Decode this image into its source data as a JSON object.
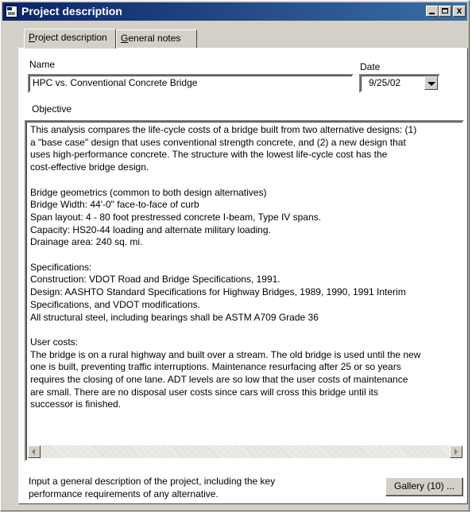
{
  "window": {
    "title": "Project description",
    "controls": {
      "minimize": "",
      "maximize": "",
      "close": "x"
    }
  },
  "tabs": [
    {
      "label_underlined": "P",
      "label_rest": "roject description",
      "active": true
    },
    {
      "label_underlined": "G",
      "label_rest": "eneral notes",
      "active": false
    }
  ],
  "form": {
    "name_label": "Name",
    "name_value": "HPC vs. Conventional Concrete Bridge",
    "date_label": "Date",
    "date_value": "9/25/02",
    "objective_label": "Objective",
    "objective_text": "This analysis compares the life-cycle costs of a bridge built from two alternative designs: (1)\na \"base case\" design that uses conventional strength concrete, and (2) a new design that\nuses high-performance concrete. The structure with the lowest life-cycle cost has the\ncost-effective bridge design.\n\nBridge geometrics (common to both design alternatives)\nBridge Width: 44'-0\" face-to-face of curb\nSpan layout: 4 - 80 foot prestressed concrete I-beam, Type IV spans.\nCapacity: HS20-44 loading and alternate military loading.\nDrainage area: 240 sq. mi.\n\nSpecifications:\nConstruction: VDOT Road and Bridge Specifications, 1991.\nDesign: AASHTO Standard Specifications for Highway Bridges, 1989, 1990, 1991 Interim\nSpecifications, and VDOT modifications.\nAll structural steel, including bearings shall be ASTM A709 Grade 36\n\nUser costs:\nThe bridge is on a rural highway and built over a stream. The old bridge is used until the new\none is built, preventing traffic interruptions. Maintenance resurfacing after 25 or so years\nrequires the closing of one lane. ADT levels are so low that the user costs of maintenance\nare small. There are no disposal user costs since cars will cross this bridge until its\nsuccessor is finished."
  },
  "footer": {
    "help_text": "Input a general description of the project, including the key\nperformance requirements of any alternative.",
    "gallery_label": "Gallery (10) ..."
  }
}
